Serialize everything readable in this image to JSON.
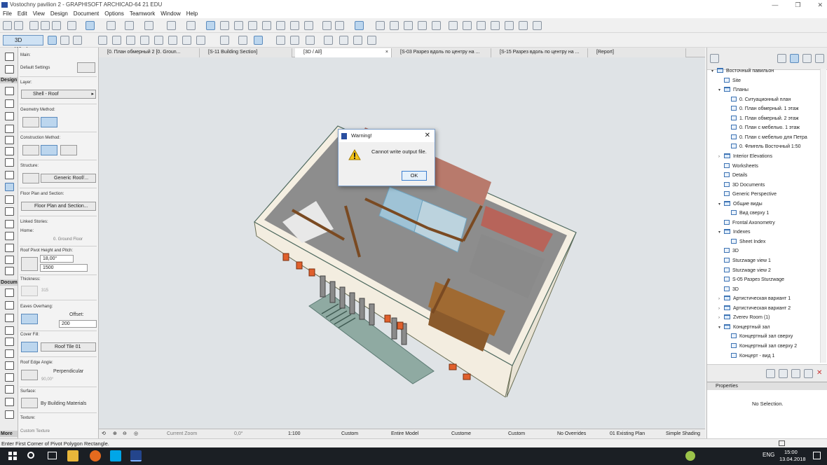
{
  "window": {
    "title": "Vostochny pavilion 2 - GRAPHISOFT ARCHICAD-64 21 EDU",
    "minimize": "—",
    "maximize": "❐",
    "close": "✕"
  },
  "menu": [
    "File",
    "Edit",
    "View",
    "Design",
    "Document",
    "Options",
    "Teamwork",
    "Window",
    "Help"
  ],
  "toolbar": {
    "btn_3d_window": "3D Window"
  },
  "tabs": [
    "[0. План обмерный 2 [0. Groun...",
    "[S-11 Building Section]",
    "[3D / All]",
    "[S-03 Разрез вдоль по центру на ...",
    "[S-15 Разрез вдоль по центру на ...",
    "[Report]"
  ],
  "toolbox": {
    "design": "Design",
    "document": "Docum",
    "more": "More"
  },
  "info": {
    "main": "Main:",
    "default_settings": "Default Settings",
    "layer_label": "Layer:",
    "layer": "Shell - Roof",
    "geometry_method": "Geometry Method:",
    "construction_method": "Construction Method:",
    "structure_label": "Structure:",
    "structure": "Generic Roof/...",
    "floor_plan_label": "Floor Plan and Section:",
    "floor_plan": "Floor Plan and Section...",
    "linked_stories": "Linked Stories:",
    "home": "Home:",
    "home_story": "0. Ground Floor",
    "pivot_label": "Roof Pivot Height and Pitch:",
    "pitch": "18,00°",
    "pivot_height": "1500",
    "thickness_label": "Thickness:",
    "thickness": "315",
    "eaves_label": "Eaves Overhang:",
    "offset_label": "Offset:",
    "offset": "200",
    "cover_fill_label": "Cover Fill:",
    "cover_fill": "Roof Tile 01",
    "edge_angle_label": "Roof Edge Angle:",
    "edge_angle": "Perpendicular",
    "edge_angle_value": "90,00°",
    "surface_label": "Surface:",
    "surface": "By Building Materials",
    "texture_label": "Texture:",
    "texture": "Custom Texture"
  },
  "status3d": {
    "zoom": "Current Zoom",
    "angle": "0,0°",
    "scale": "1:100",
    "layer_combo": "Custom",
    "model": "Entire Model",
    "pen_set": "Custome",
    "mvo": "Custom",
    "overrides": "No Overrides",
    "renovation": "01 Existing Plan",
    "shading": "Simple Shading"
  },
  "navigator": [
    {
      "label": "Восточный павильон",
      "depth": 0,
      "kind": "root",
      "exp": "▾"
    },
    {
      "label": "Site",
      "depth": 1,
      "kind": "item",
      "exp": ""
    },
    {
      "label": "Планы",
      "depth": 1,
      "kind": "folder",
      "exp": "▾"
    },
    {
      "label": "0. Ситуационный план",
      "depth": 2,
      "kind": "item",
      "exp": ""
    },
    {
      "label": "0. План обмерный. 1 этаж",
      "depth": 2,
      "kind": "item",
      "exp": ""
    },
    {
      "label": "1. План обмерный. 2 этаж",
      "depth": 2,
      "kind": "item",
      "exp": ""
    },
    {
      "label": "0. План с мебелью. 1 этаж",
      "depth": 2,
      "kind": "item",
      "exp": ""
    },
    {
      "label": "0. План с мебелью для Петра",
      "depth": 2,
      "kind": "item",
      "exp": ""
    },
    {
      "label": "0. Флигель Восточный 1:50",
      "depth": 2,
      "kind": "item",
      "exp": ""
    },
    {
      "label": "Interior Elevations",
      "depth": 1,
      "kind": "folder",
      "exp": "›"
    },
    {
      "label": "Worksheets",
      "depth": 1,
      "kind": "item",
      "exp": ""
    },
    {
      "label": "Details",
      "depth": 1,
      "kind": "item",
      "exp": ""
    },
    {
      "label": "3D Documents",
      "depth": 1,
      "kind": "item",
      "exp": ""
    },
    {
      "label": "Generic Perspective",
      "depth": 1,
      "kind": "item",
      "exp": ""
    },
    {
      "label": "Общие виды",
      "depth": 1,
      "kind": "folder",
      "exp": "▾"
    },
    {
      "label": "Вид сверху 1",
      "depth": 2,
      "kind": "item",
      "exp": ""
    },
    {
      "label": "Frontal Axonometry",
      "depth": 1,
      "kind": "item",
      "exp": ""
    },
    {
      "label": "Indexes",
      "depth": 1,
      "kind": "folder",
      "exp": "▾"
    },
    {
      "label": "Sheet Index",
      "depth": 2,
      "kind": "item",
      "exp": ""
    },
    {
      "label": "3D",
      "depth": 1,
      "kind": "item",
      "exp": ""
    },
    {
      "label": "Sturzwage view 1",
      "depth": 1,
      "kind": "item",
      "exp": ""
    },
    {
      "label": "Sturzwage view 2",
      "depth": 1,
      "kind": "item",
      "exp": ""
    },
    {
      "label": "S-05 Разрез Sturzwage",
      "depth": 1,
      "kind": "item",
      "exp": ""
    },
    {
      "label": "3D",
      "depth": 1,
      "kind": "item",
      "exp": ""
    },
    {
      "label": "Артистическая вариант 1",
      "depth": 1,
      "kind": "folder",
      "exp": "›"
    },
    {
      "label": "Артистическая вариант 2",
      "depth": 1,
      "kind": "folder",
      "exp": "›"
    },
    {
      "label": "Zverev Room (1)",
      "depth": 1,
      "kind": "folder",
      "exp": "›"
    },
    {
      "label": "Концертный зал",
      "depth": 1,
      "kind": "folder",
      "exp": "▾"
    },
    {
      "label": "Концертный зал сверху",
      "depth": 2,
      "kind": "item",
      "exp": ""
    },
    {
      "label": "Концертный зал сверху 2",
      "depth": 2,
      "kind": "item",
      "exp": ""
    },
    {
      "label": "Концерт - вид 1",
      "depth": 2,
      "kind": "item",
      "exp": ""
    }
  ],
  "properties": {
    "header": "Properties",
    "empty": "No Selection."
  },
  "status_message": "Enter First Corner of Pivot Polygon Rectangle.",
  "dialog": {
    "title": "Warning!",
    "message": "Cannot write output file.",
    "ok": "OK"
  },
  "taskbar": {
    "time": "15:00",
    "date": "13.04.2018",
    "lang": "ENG"
  }
}
